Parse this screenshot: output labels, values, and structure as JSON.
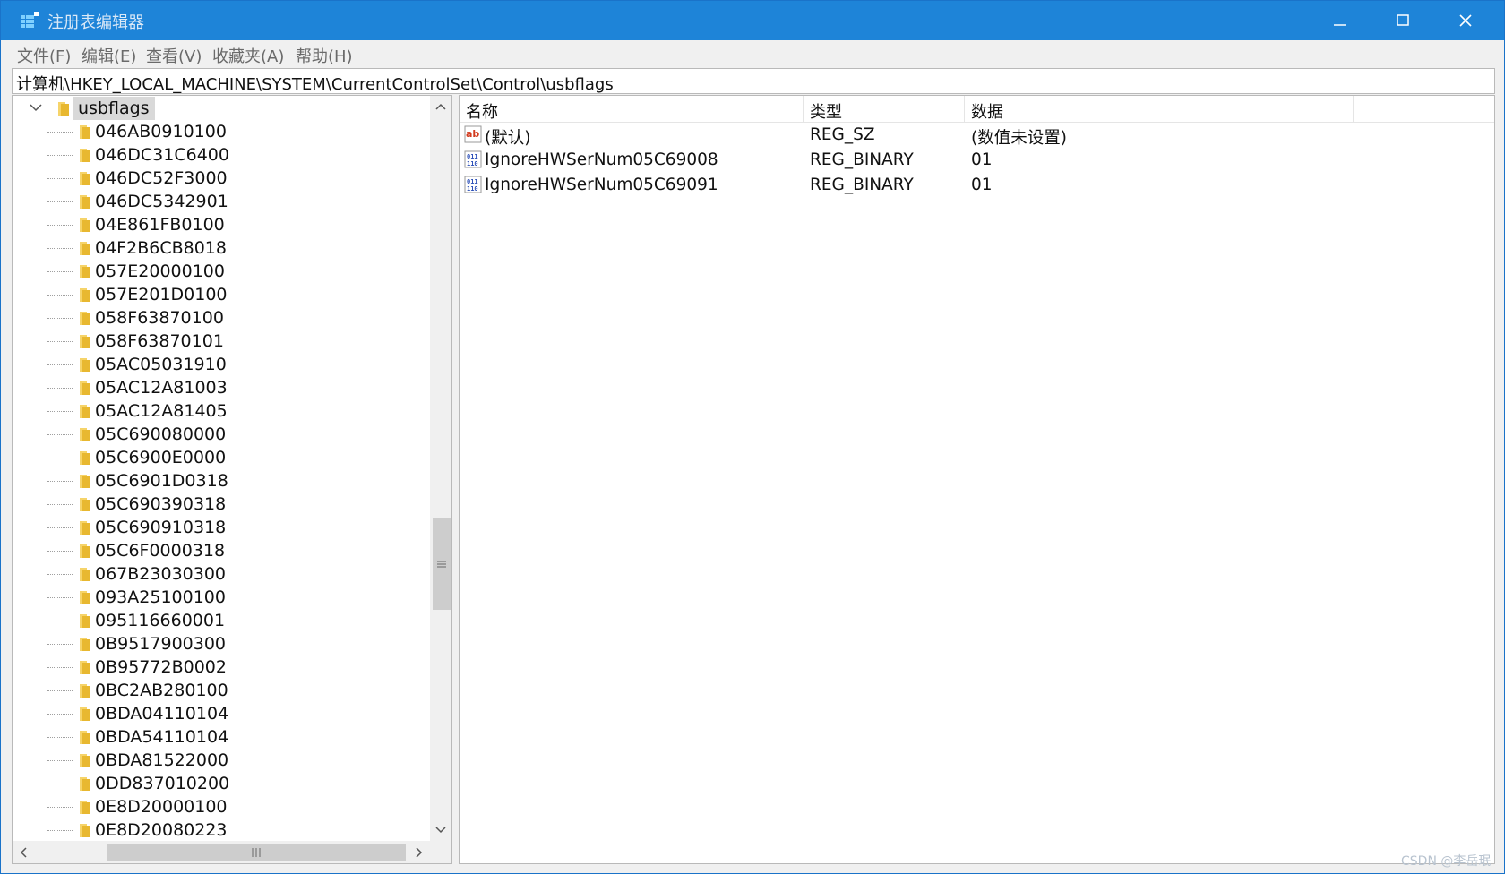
{
  "window": {
    "title": "注册表编辑器"
  },
  "menu": [
    "文件(F)",
    "编辑(E)",
    "查看(V)",
    "收藏夹(A)",
    "帮助(H)"
  ],
  "address": "计算机\\HKEY_LOCAL_MACHINE\\SYSTEM\\CurrentControlSet\\Control\\usbflags",
  "tree": {
    "root": "usbflags",
    "items": [
      "046AB0910100",
      "046DC31C6400",
      "046DC52F3000",
      "046DC5342901",
      "04E861FB0100",
      "04F2B6CB8018",
      "057E20000100",
      "057E201D0100",
      "058F63870100",
      "058F63870101",
      "05AC05031910",
      "05AC12A81003",
      "05AC12A81405",
      "05C690080000",
      "05C6900E0000",
      "05C6901D0318",
      "05C690390318",
      "05C690910318",
      "05C6F0000318",
      "067B23030300",
      "093A25100100",
      "095116660001",
      "0B9517900300",
      "0B95772B0002",
      "0BC2AB280100",
      "0BDA04110104",
      "0BDA54110104",
      "0BDA81522000",
      "0DD837010200",
      "0E8D20000100",
      "0E8D20080223"
    ]
  },
  "list": {
    "columns": [
      "名称",
      "类型",
      "数据"
    ],
    "rows": [
      {
        "icon": "string-value-icon",
        "name": "(默认)",
        "type": "REG_SZ",
        "data": "(数值未设置)"
      },
      {
        "icon": "binary-value-icon",
        "name": "IgnoreHWSerNum05C69008",
        "type": "REG_BINARY",
        "data": "01"
      },
      {
        "icon": "binary-value-icon",
        "name": "IgnoreHWSerNum05C69091",
        "type": "REG_BINARY",
        "data": "01"
      }
    ]
  },
  "watermark": "CSDN @李岳珉",
  "colors": {
    "titlebar": "#1e84d8",
    "folder": "#e8b830"
  }
}
